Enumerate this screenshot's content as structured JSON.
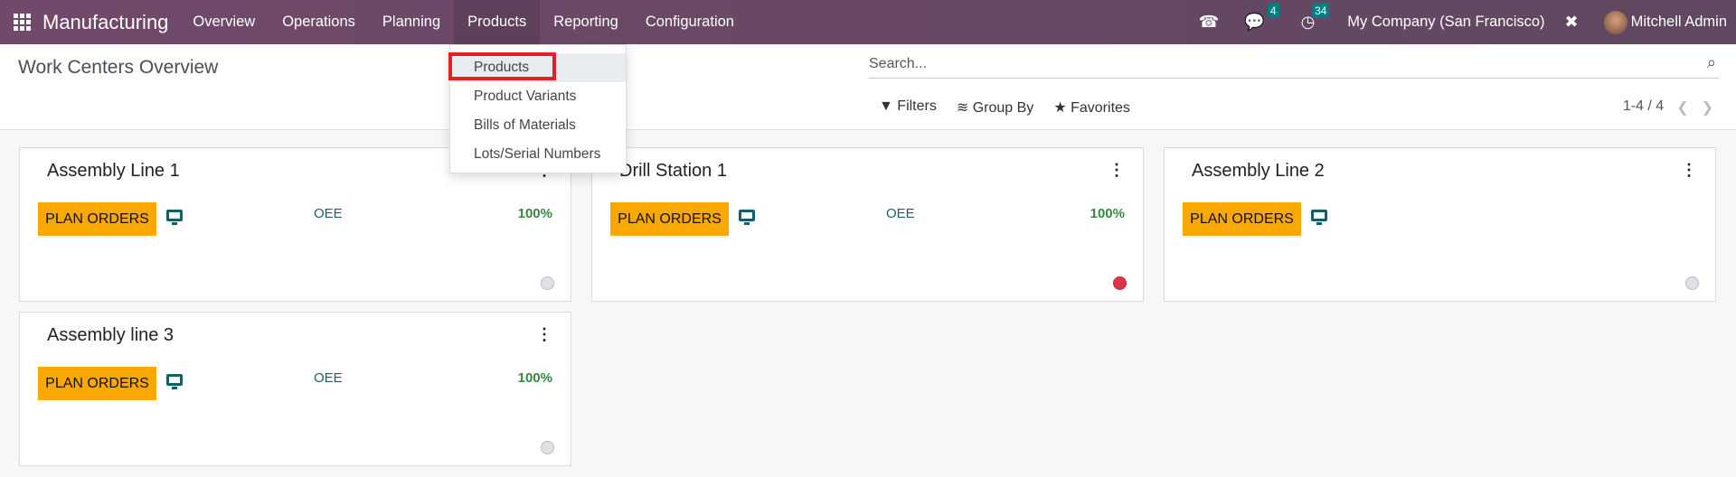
{
  "navbar": {
    "app_name": "Manufacturing",
    "menus": [
      "Overview",
      "Operations",
      "Planning",
      "Products",
      "Reporting",
      "Configuration"
    ],
    "active_menu": "Products",
    "messages_count": "4",
    "activities_count": "34",
    "company": "My Company (San Francisco)",
    "user": "Mitchell Admin"
  },
  "control": {
    "title": "Work Centers Overview",
    "search_placeholder": "Search...",
    "filters": "Filters",
    "group_by": "Group By",
    "favorites": "Favorites",
    "pager": "1-4 / 4"
  },
  "dropdown": {
    "items": [
      "Products",
      "Product Variants",
      "Bills of Materials",
      "Lots/Serial Numbers"
    ],
    "highlighted": "Products"
  },
  "cards": [
    {
      "name": "Assembly Line 1",
      "button": "PLAN ORDERS",
      "oee_label": "OEE",
      "oee": "100%",
      "status": "gray"
    },
    {
      "name": "Drill Station 1",
      "button": "PLAN ORDERS",
      "oee_label": "OEE",
      "oee": "100%",
      "status": "red"
    },
    {
      "name": "Assembly Line 2",
      "button": "PLAN ORDERS",
      "status": "gray"
    },
    {
      "name": "Assembly line 3",
      "button": "PLAN ORDERS",
      "oee_label": "OEE",
      "oee": "100%",
      "status": "gray"
    }
  ],
  "colors": {
    "navbar": "#71496a",
    "plan_button": "#f9a800",
    "badge": "#017e84",
    "oee_value": "#338a3e",
    "status_red": "#dc3545",
    "highlight_box": "#e3202a"
  }
}
